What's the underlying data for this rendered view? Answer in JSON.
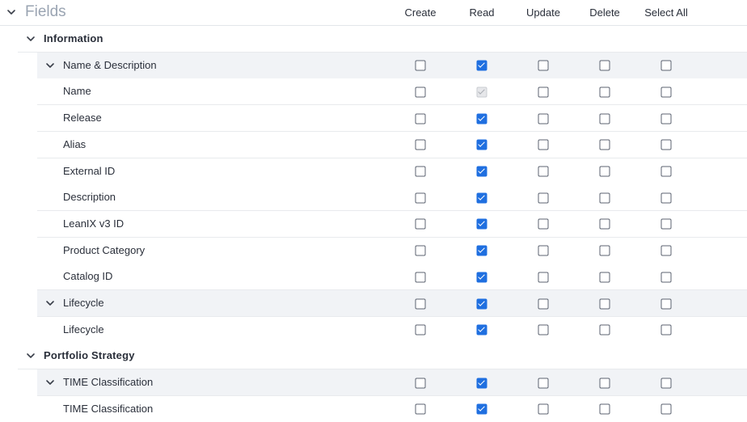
{
  "header": {
    "title": "Fields",
    "columns": [
      "Create",
      "Read",
      "Update",
      "Delete",
      "Select All"
    ]
  },
  "rows": [
    {
      "type": "section",
      "label": "Information",
      "values": null
    },
    {
      "type": "group",
      "label": "Name & Description",
      "values": [
        false,
        true,
        false,
        false,
        false
      ]
    },
    {
      "type": "field",
      "label": "Name",
      "values": [
        false,
        true,
        false,
        false,
        false
      ],
      "disabled": [
        false,
        true,
        false,
        false,
        false
      ]
    },
    {
      "type": "field",
      "label": "Release",
      "values": [
        false,
        true,
        false,
        false,
        false
      ]
    },
    {
      "type": "field",
      "label": "Alias",
      "values": [
        false,
        true,
        false,
        false,
        false
      ]
    },
    {
      "type": "field",
      "label": "External ID",
      "values": [
        false,
        true,
        false,
        false,
        false
      ]
    },
    {
      "type": "field",
      "label": "Description",
      "values": [
        false,
        true,
        false,
        false,
        false
      ]
    },
    {
      "type": "field",
      "label": "LeanIX v3 ID",
      "values": [
        false,
        true,
        false,
        false,
        false
      ]
    },
    {
      "type": "field",
      "label": "Product Category",
      "values": [
        false,
        true,
        false,
        false,
        false
      ]
    },
    {
      "type": "field",
      "label": "Catalog ID",
      "values": [
        false,
        true,
        false,
        false,
        false
      ]
    },
    {
      "type": "group",
      "label": "Lifecycle",
      "values": [
        false,
        true,
        false,
        false,
        false
      ]
    },
    {
      "type": "field",
      "label": "Lifecycle",
      "values": [
        false,
        true,
        false,
        false,
        false
      ]
    },
    {
      "type": "section",
      "label": "Portfolio Strategy",
      "values": null
    },
    {
      "type": "group",
      "label": "TIME Classification",
      "values": [
        false,
        true,
        false,
        false,
        false
      ]
    },
    {
      "type": "field",
      "label": "TIME Classification",
      "values": [
        false,
        true,
        false,
        false,
        false
      ]
    }
  ],
  "colors": {
    "accent": "#1f6fe0",
    "group_bg": "#f1f3f6",
    "title_muted": "#9aa4b2"
  }
}
